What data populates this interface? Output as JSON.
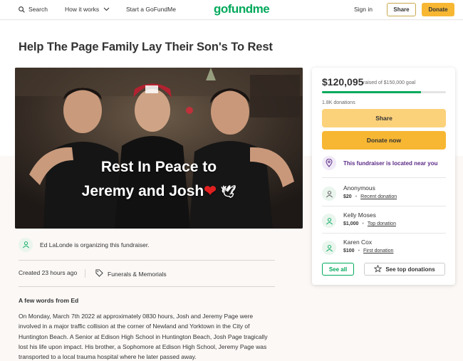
{
  "nav": {
    "search_label": "Search",
    "how_it_works_label": "How it works",
    "start_label": "Start a GoFundMe",
    "logo_text": "gofundme",
    "sign_in_label": "Sign in",
    "share_label": "Share",
    "donate_label": "Donate"
  },
  "campaign": {
    "title": "Help The Page Family Lay Their Son's To Rest",
    "image_caption_line1": "Rest In Peace to",
    "image_caption_line2": "Jeremy and Josh",
    "organizer_text": "Ed LaLonde is organizing this fundraiser.",
    "created": "Created 23 hours ago",
    "category": "Funerals & Memorials",
    "story_heading": "A few words from Ed",
    "story": "On Monday, March 7th 2022 at approximately 0830 hours, Josh and Jeremy Page were involved in a major traffic collision at the corner of Newland and Yorktown in the City of Huntington Beach. A Senior at Edison High School in Huntington Beach, Josh Page tragically lost his life upon impact. His brother, a Sophomore at Edison High School, Jeremy Page was transported to a local trauma hospital where he later passed away."
  },
  "sidebar": {
    "amount": "$120,095",
    "goal_text": "raised of $150,000 goal",
    "progress_fraction": 0.8,
    "donations_count": "1.8K donations",
    "share_label": "Share",
    "donate_label": "Donate now",
    "near_you_text": "This fundraiser is located near you",
    "donors": [
      {
        "name": "Anonymous",
        "amount": "$20",
        "tag": "Recent donation"
      },
      {
        "name": "Kelly Moses",
        "amount": "$1,000",
        "tag": "Top donation"
      },
      {
        "name": "Karen Cox",
        "amount": "$100",
        "tag": "First donation"
      }
    ],
    "see_all_label": "See all",
    "see_top_label": "See top donations"
  },
  "colors": {
    "brand_green": "#02a95c",
    "donate_orange": "#f7b733",
    "share_yellow": "#fbd17a",
    "near_purple": "#5b2a86"
  }
}
